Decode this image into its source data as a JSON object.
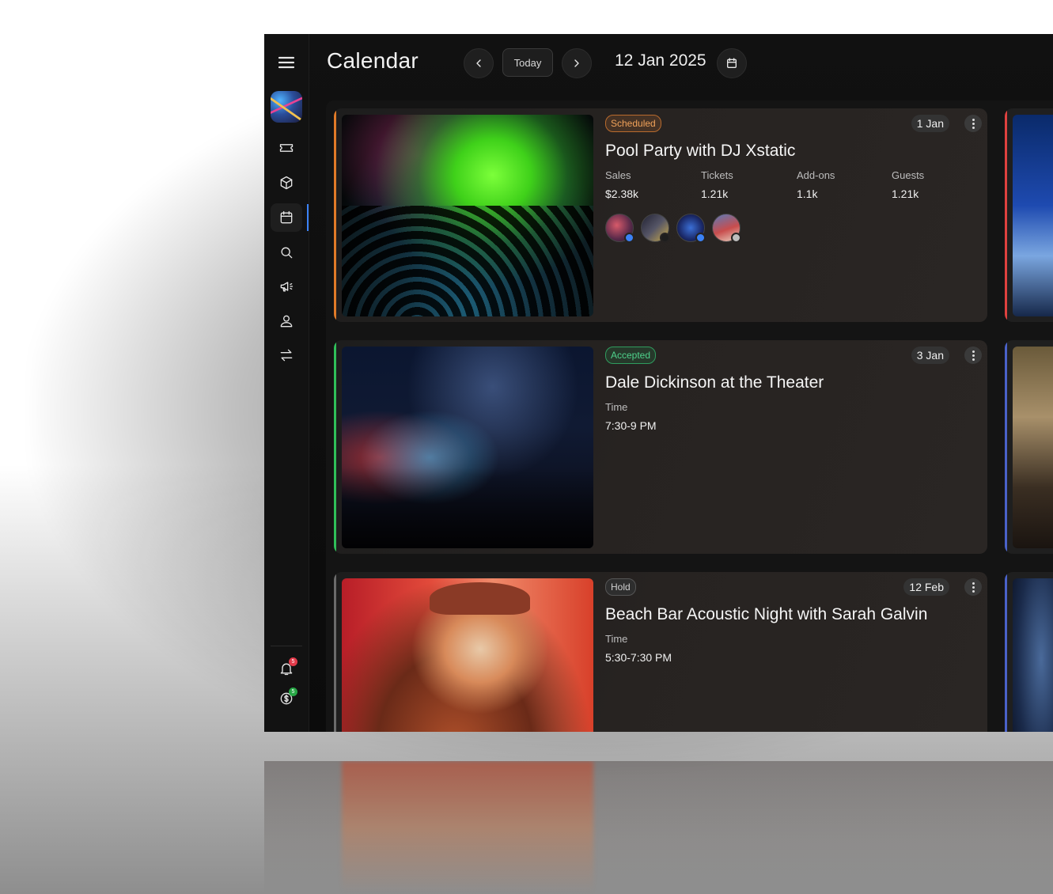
{
  "header": {
    "title": "Calendar",
    "today_label": "Today",
    "date": "12 Jan 2025"
  },
  "sidebar": {
    "items": [
      {
        "name": "tickets",
        "icon": "ticket-icon"
      },
      {
        "name": "products",
        "icon": "box-icon"
      },
      {
        "name": "calendar",
        "icon": "calendar-icon",
        "active": true
      },
      {
        "name": "search",
        "icon": "search-icon"
      },
      {
        "name": "marketing",
        "icon": "megaphone-icon"
      },
      {
        "name": "profile",
        "icon": "user-icon"
      },
      {
        "name": "transfers",
        "icon": "swap-icon"
      }
    ],
    "notifications_count": "5",
    "payments_count": "5"
  },
  "events": [
    {
      "status": "Scheduled",
      "date": "1 Jan",
      "title": "Pool Party with DJ Xstatic",
      "accent": "#e07a28",
      "stats": [
        {
          "label": "Sales",
          "value": "$2.38k"
        },
        {
          "label": "Tickets",
          "value": "1.21k"
        },
        {
          "label": "Add-ons",
          "value": "1.1k"
        },
        {
          "label": "Guests",
          "value": "1.21k"
        }
      ]
    },
    {
      "status": "Accepted",
      "date": "3 Jan",
      "title": "Dale Dickinson at the Theater",
      "accent": "#2fbf59",
      "time_label": "Time",
      "time": "7:30-9 PM"
    },
    {
      "status": "Hold",
      "date": "12 Feb",
      "title": "Beach Bar Acoustic Night with Sarah Galvin",
      "accent": "#6b6b6b",
      "time_label": "Time",
      "time": "5:30-7:30 PM"
    }
  ],
  "colors": {
    "active_indicator": "#3b82f6",
    "peek_accent_1": "#e0413f",
    "peek_accent_2": "#4a62c9",
    "peek_accent_3": "#4a62c9"
  }
}
